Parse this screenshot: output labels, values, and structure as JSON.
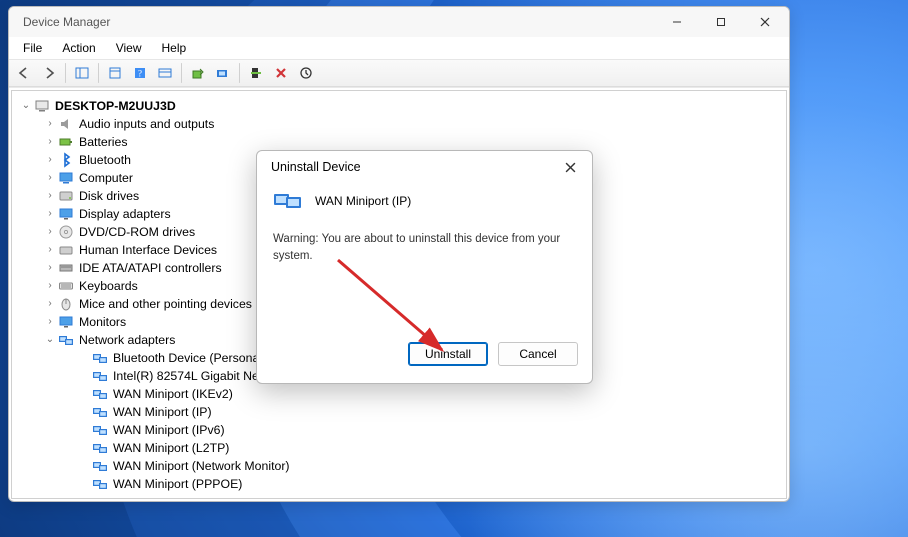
{
  "window": {
    "title": "Device Manager",
    "menus": {
      "file": "File",
      "action": "Action",
      "view": "View",
      "help": "Help"
    },
    "win_controls": {
      "min": "—",
      "max": "▢",
      "close": "✕"
    }
  },
  "tree": {
    "root": "DESKTOP-M2UUJ3D",
    "categories": [
      {
        "label": "Audio inputs and outputs",
        "icon": "audio"
      },
      {
        "label": "Batteries",
        "icon": "battery"
      },
      {
        "label": "Bluetooth",
        "icon": "bluetooth"
      },
      {
        "label": "Computer",
        "icon": "computer"
      },
      {
        "label": "Disk drives",
        "icon": "disk"
      },
      {
        "label": "Display adapters",
        "icon": "display"
      },
      {
        "label": "DVD/CD-ROM drives",
        "icon": "dvd"
      },
      {
        "label": "Human Interface Devices",
        "icon": "hid"
      },
      {
        "label": "IDE ATA/ATAPI controllers",
        "icon": "ide"
      },
      {
        "label": "Keyboards",
        "icon": "keyboard"
      },
      {
        "label": "Mice and other pointing devices",
        "icon": "mouse"
      },
      {
        "label": "Monitors",
        "icon": "monitor"
      },
      {
        "label": "Network adapters",
        "icon": "network",
        "expanded": true,
        "children": [
          "Bluetooth Device (Personal Area",
          "Intel(R) 82574L Gigabit Network",
          "WAN Miniport (IKEv2)",
          "WAN Miniport (IP)",
          "WAN Miniport (IPv6)",
          "WAN Miniport (L2TP)",
          "WAN Miniport (Network Monitor)",
          "WAN Miniport (PPPOE)"
        ]
      }
    ]
  },
  "dialog": {
    "title": "Uninstall Device",
    "device_name": "WAN Miniport (IP)",
    "warning": "Warning: You are about to uninstall this device from your system.",
    "uninstall": "Uninstall",
    "cancel": "Cancel"
  }
}
